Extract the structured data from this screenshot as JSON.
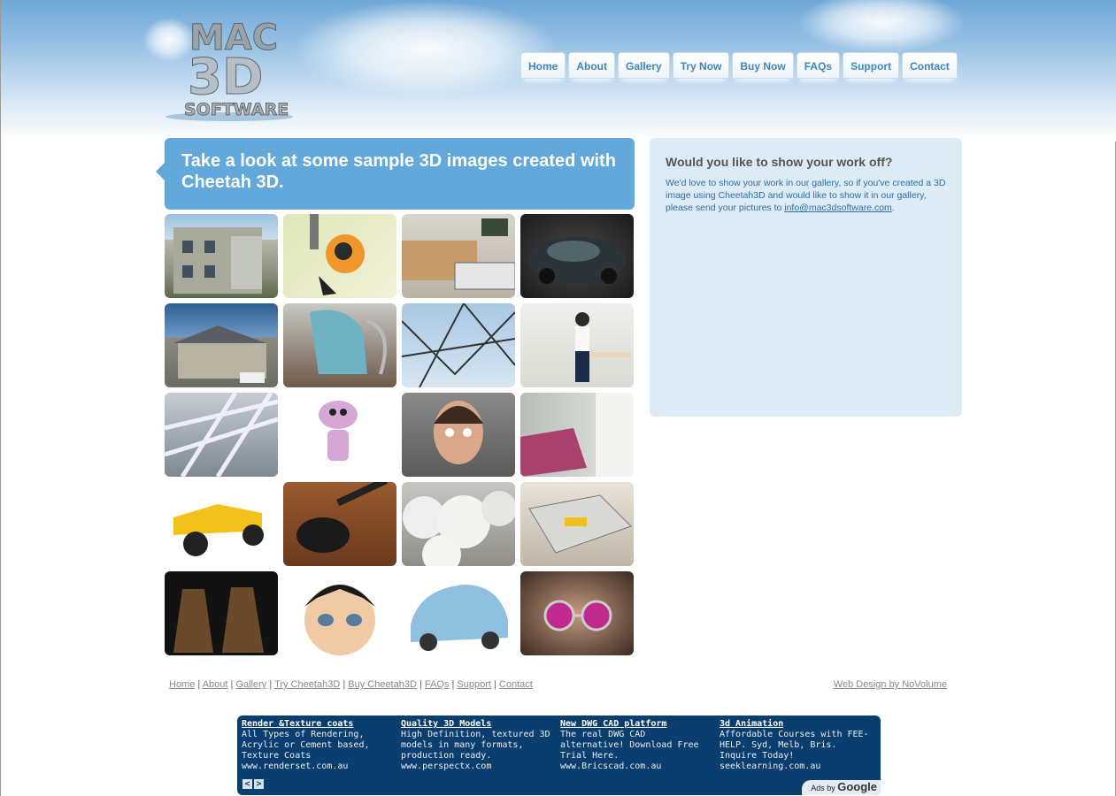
{
  "logo": {
    "line1": "MAC",
    "line2": "3D",
    "line3": "SOFTWARE"
  },
  "nav": [
    "Home",
    "About",
    "Gallery",
    "Try Now",
    "Buy Now",
    "FAQs",
    "Support",
    "Contact"
  ],
  "banner": {
    "title": "Take a look at some sample 3D images created with Cheetah 3D."
  },
  "sidebar": {
    "heading": "Would you like to show your work off?",
    "text_before": "We'd love to show your work in our gallery, so if you've created a 3D image using Cheetah3D and would like to show it in our gallery, please send your pictures to ",
    "email": "info@mac3dsoftware.com",
    "text_after": "."
  },
  "gallery": [
    {
      "name": "apartment-building"
    },
    {
      "name": "orange-robot"
    },
    {
      "name": "living-room-sofa"
    },
    {
      "name": "dark-concept-car"
    },
    {
      "name": "suburban-house"
    },
    {
      "name": "blue-chair"
    },
    {
      "name": "glass-structure"
    },
    {
      "name": "girl-at-desk"
    },
    {
      "name": "steel-atrium"
    },
    {
      "name": "pink-alien"
    },
    {
      "name": "woman-face"
    },
    {
      "name": "pink-lounge-chair"
    },
    {
      "name": "yellow-buggy"
    },
    {
      "name": "black-guitar"
    },
    {
      "name": "cheetah-balls"
    },
    {
      "name": "lego-spaceship"
    },
    {
      "name": "daleks"
    },
    {
      "name": "cartoon-girl-face"
    },
    {
      "name": "blue-cartoon-car"
    },
    {
      "name": "man-pink-glasses"
    }
  ],
  "footer": {
    "links": [
      "Home",
      "About",
      "Gallery",
      "Try Cheetah3D",
      "Buy Cheetah3D",
      "FAQs",
      "Support",
      "Contact"
    ],
    "credit": "Web Design by NoVolume"
  },
  "ads": [
    {
      "title": "Render &Texture coats",
      "desc": "All Types of Rendering, Acrylic or Cement based, Texture Coats",
      "url": "www.renderset.com.au"
    },
    {
      "title": "Quality 3D Models",
      "desc": "High Definition, textured 3D models in many formats, production ready.",
      "url": "www.perspectx.com"
    },
    {
      "title": "New DWG CAD platform",
      "desc": "The real DWG CAD alternative! Download Free Trial Here.",
      "url": "www.Bricscad.com.au"
    },
    {
      "title": "3d Animation",
      "desc": "Affordable Courses with FEE-HELP. Syd, Melb, Bris. Inquire Today!",
      "url": "seeklearning.com.au"
    }
  ],
  "ads_footer": {
    "prev": "<",
    "next": ">",
    "label": "Ads by",
    "brand": "Google"
  }
}
